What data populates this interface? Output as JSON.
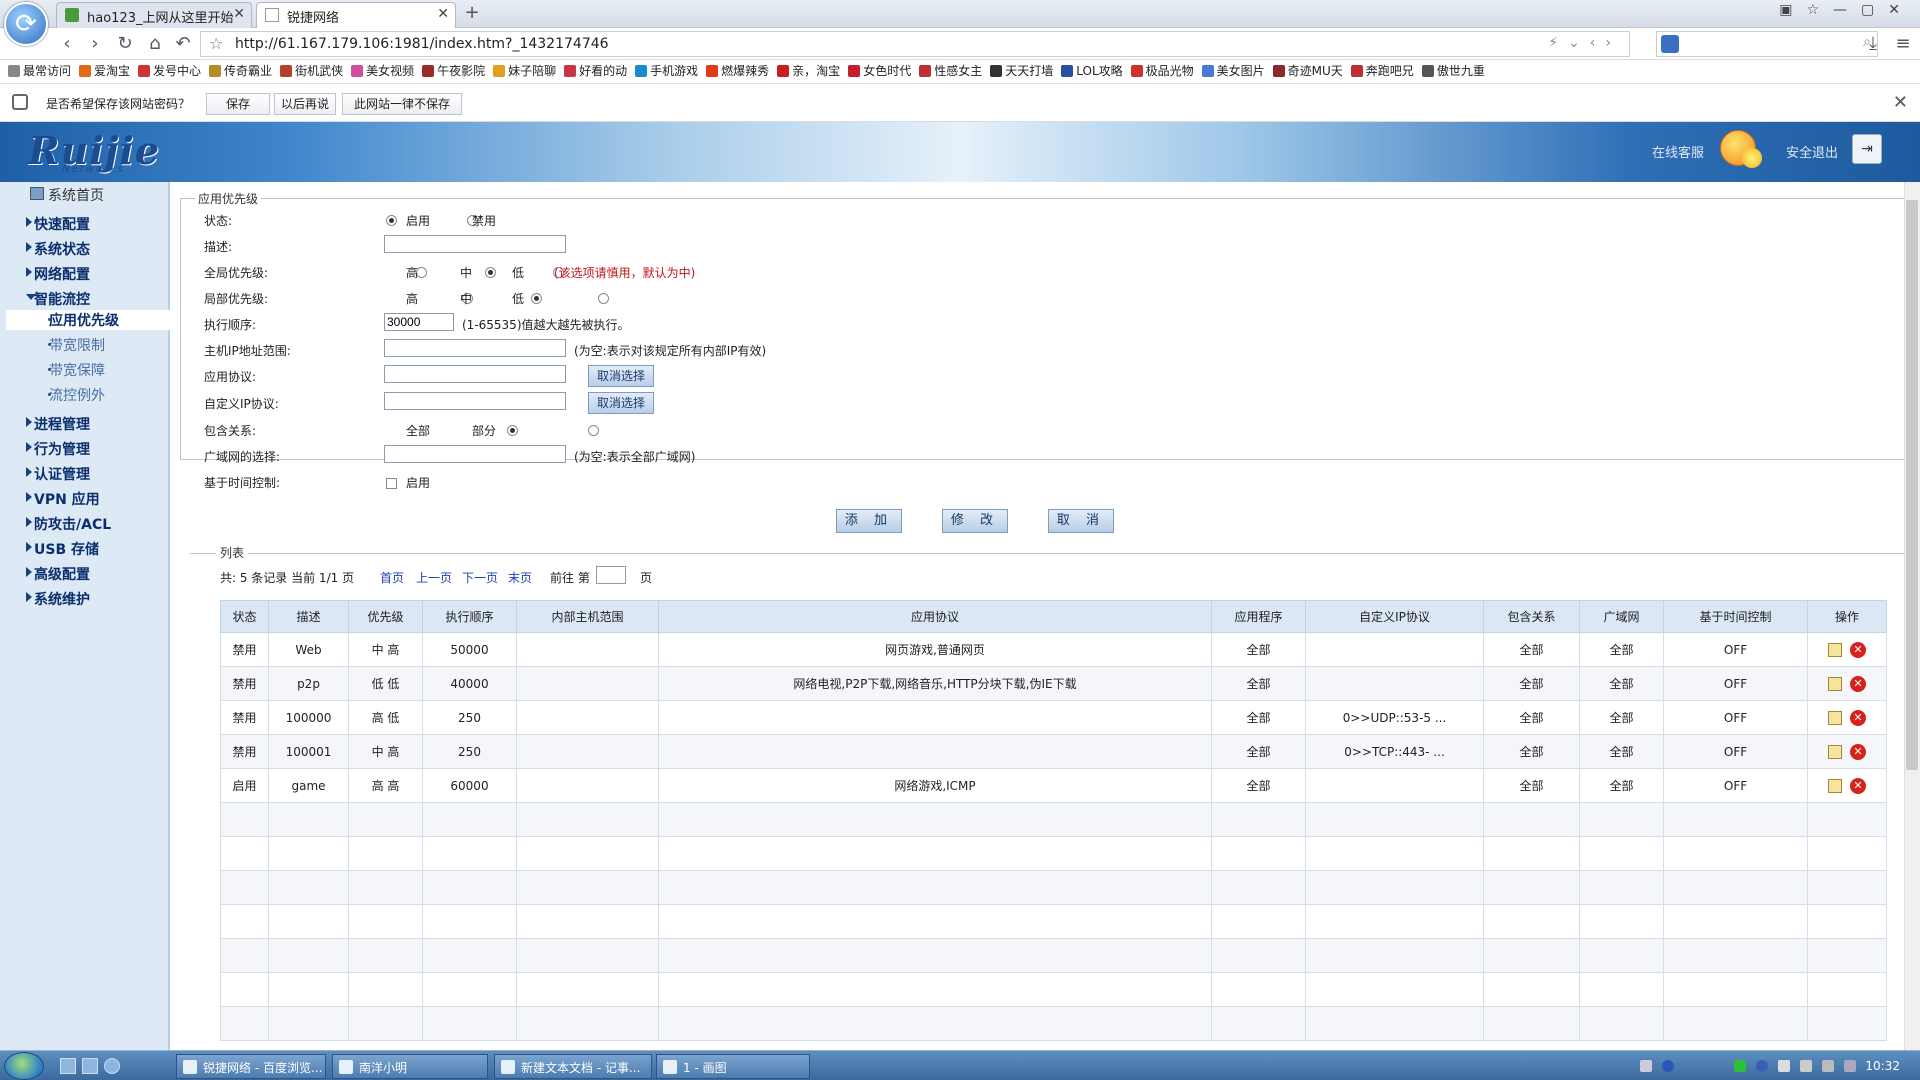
{
  "browser": {
    "tabs": [
      {
        "label": "hao123_上网从这里开始"
      },
      {
        "label": "锐捷网络"
      }
    ],
    "url": "http://61.167.179.106:1981/index.htm?_1432174746",
    "bookmarks": [
      "最常访问",
      "爱淘宝",
      "发号中心",
      "传奇霸业",
      "街机武侠",
      "美女视频",
      "午夜影院",
      "妹子陪聊",
      "好看的动",
      "手机游戏",
      "燃爆辣秀",
      "亲，淘宝",
      "女色时代",
      "性感女主",
      "天天打墙",
      "LOL攻略",
      "极品光物",
      "美女图片",
      "奇迹MU天",
      "奔跑吧兄",
      "傲世九重"
    ],
    "password_bar": {
      "question": "是否希望保存该网站密码？",
      "save": "保存",
      "later": "以后再说",
      "never": "此网站一律不保存"
    }
  },
  "header": {
    "logo": "Ruijie",
    "logo_sub": "Networks",
    "service": "在线客服",
    "logout": "安全退出"
  },
  "sidebar": {
    "home": "系统首页",
    "items": [
      {
        "label": "快速配置"
      },
      {
        "label": "系统状态"
      },
      {
        "label": "网络配置"
      },
      {
        "label": "智能流控",
        "children": [
          "应用优先级",
          "带宽限制",
          "带宽保障",
          "流控例外"
        ],
        "active_child": "应用优先级"
      },
      {
        "label": "进程管理"
      },
      {
        "label": "行为管理"
      },
      {
        "label": "认证管理"
      },
      {
        "label": "VPN 应用"
      },
      {
        "label": "防攻击/ACL"
      },
      {
        "label": "USB 存储"
      },
      {
        "label": "高级配置"
      },
      {
        "label": "系统维护"
      }
    ]
  },
  "form": {
    "legend": "应用优先级",
    "status_label": "状态:",
    "status_on": "启用",
    "status_off": "禁用",
    "status_value": "启用",
    "desc_label": "描述:",
    "desc_value": "",
    "global_label": "全局优先级:",
    "local_label": "局部优先级:",
    "high": "高",
    "mid": "中",
    "low": "低",
    "global_note": "(该选项请慎用，默认为中)",
    "order_label": "执行顺序:",
    "order_value": "30000",
    "order_note": "(1-65535)值越大越先被执行。",
    "host_label": "主机IP地址范围:",
    "host_note": "(为空:表示对该规定所有内部IP有效)",
    "proto_label": "应用协议:",
    "custom_label": "自定义IP协议:",
    "cancel_select": "取消选择",
    "include_label": "包含关系:",
    "include_all": "全部",
    "include_part": "部分",
    "wan_label": "广域网的选择:",
    "wan_note": "(为空:表示全部广域网)",
    "time_label": "基于时间控制:",
    "time_enable": "启用",
    "btn_add": "添 加",
    "btn_edit": "修 改",
    "btn_cancel": "取 消"
  },
  "list": {
    "legend": "列表",
    "summary": "共: 5 条记录  当前 1/1 页",
    "first": "首页",
    "prev": "上一页",
    "next": "下一页",
    "last": "末页",
    "goto": "前往 第",
    "page_unit": "页",
    "headers": [
      "状态",
      "描述",
      "优先级",
      "执行顺序",
      "内部主机范围",
      "应用协议",
      "应用程序",
      "自定义IP协议",
      "包含关系",
      "广域网",
      "基于时间控制",
      "操作"
    ],
    "rows": [
      [
        "禁用",
        "Web",
        "中 高",
        "50000",
        "",
        "网页游戏,普通网页",
        "全部",
        "",
        "全部",
        "全部",
        "OFF"
      ],
      [
        "禁用",
        "p2p",
        "低 低",
        "40000",
        "",
        "网络电视,P2P下载,网络音乐,HTTP分块下载,伪IE下载",
        "全部",
        "",
        "全部",
        "全部",
        "OFF"
      ],
      [
        "禁用",
        "100000",
        "高 低",
        "250",
        "",
        "",
        "全部",
        "0>>UDP::53-5 ...",
        "全部",
        "全部",
        "OFF"
      ],
      [
        "禁用",
        "100001",
        "中 高",
        "250",
        "",
        "",
        "全部",
        "0>>TCP::443- ...",
        "全部",
        "全部",
        "OFF"
      ],
      [
        "启用",
        "game",
        "高 高",
        "60000",
        "",
        "网络游戏,ICMP",
        "全部",
        "",
        "全部",
        "全部",
        "OFF"
      ]
    ]
  },
  "taskbar": {
    "tasks": [
      "锐捷网络 - 百度浏览...",
      "南洋小明",
      "新建文本文档 - 记事...",
      "1 - 画图"
    ],
    "time": "10:32"
  }
}
